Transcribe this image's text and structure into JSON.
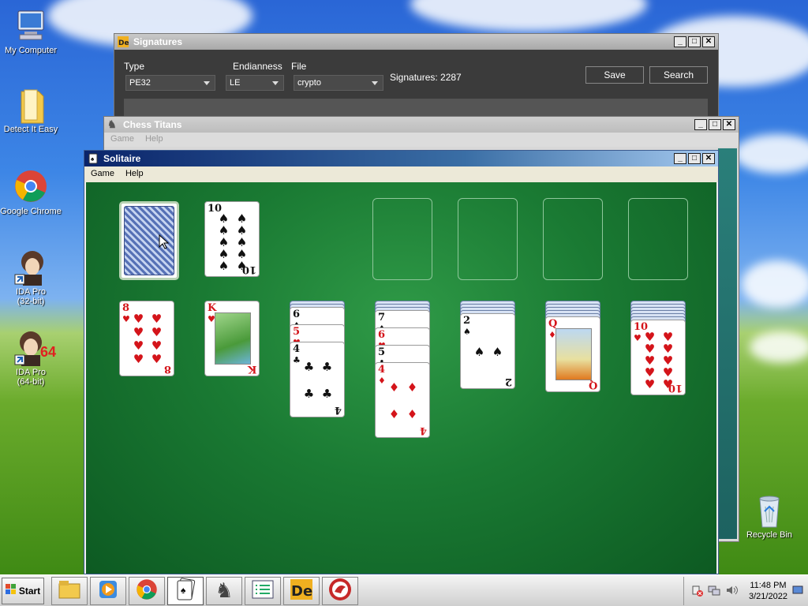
{
  "desktop": {
    "icons": [
      {
        "label": "My Computer",
        "icon": "my-computer-icon"
      },
      {
        "label": "Detect It Easy",
        "icon": "folder-icon"
      },
      {
        "label": "Google Chrome",
        "icon": "chrome-icon"
      },
      {
        "label": "IDA Pro",
        "sublabel": "(32-bit)",
        "icon": "ida-pro-icon"
      },
      {
        "label": "IDA Pro",
        "sublabel": "(64-bit)",
        "badge": "64",
        "icon": "ida-pro-64-icon"
      },
      {
        "label": "Recycle Bin",
        "icon": "recycle-bin-icon"
      }
    ]
  },
  "die_window": {
    "title": "Signatures",
    "type_label": "Type",
    "type_value": "PE32",
    "endianness_label": "Endianness",
    "endianness_value": "LE",
    "file_label": "File",
    "file_value": "crypto",
    "signatures_text": "Signatures: 2287",
    "save_label": "Save",
    "search_label": "Search"
  },
  "chess_window": {
    "title": "Chess Titans",
    "menu": [
      "Game",
      "Help"
    ]
  },
  "solitaire_window": {
    "title": "Solitaire",
    "menu": [
      "Game",
      "Help"
    ],
    "waste_card": {
      "rank": "10",
      "suit": "♠",
      "color": "black"
    },
    "tableau": [
      {
        "hidden": 0,
        "cards": [
          {
            "rank": "8",
            "suit": "♥",
            "color": "red"
          }
        ]
      },
      {
        "hidden": 0,
        "cards": [
          {
            "rank": "K",
            "suit": "♥",
            "color": "red",
            "face": true
          }
        ]
      },
      {
        "hidden": 2,
        "cards": [
          {
            "rank": "6",
            "suit": "♠",
            "color": "black"
          },
          {
            "rank": "5",
            "suit": "♥",
            "color": "red"
          },
          {
            "rank": "4",
            "suit": "♣",
            "color": "black"
          }
        ]
      },
      {
        "hidden": 3,
        "cards": [
          {
            "rank": "7",
            "suit": "♠",
            "color": "black"
          },
          {
            "rank": "6",
            "suit": "♥",
            "color": "red"
          },
          {
            "rank": "5",
            "suit": "♣",
            "color": "black"
          },
          {
            "rank": "4",
            "suit": "♦",
            "color": "red"
          }
        ]
      },
      {
        "hidden": 4,
        "cards": [
          {
            "rank": "2",
            "suit": "♠",
            "color": "black"
          }
        ]
      },
      {
        "hidden": 5,
        "cards": [
          {
            "rank": "Q",
            "suit": "♦",
            "color": "red",
            "face": true
          }
        ]
      },
      {
        "hidden": 6,
        "cards": [
          {
            "rank": "10",
            "suit": "♥",
            "color": "red"
          }
        ]
      }
    ]
  },
  "taskbar": {
    "start_label": "Start",
    "apps": [
      "file-explorer-icon",
      "media-player-icon",
      "chrome-icon",
      "solitaire-icon",
      "chess-icon",
      "task-list-icon",
      "detect-it-easy-icon",
      "ida-icon"
    ],
    "active_app": "solitaire-icon",
    "time": "11:48 PM",
    "date": "3/21/2022"
  },
  "colors": {
    "felt": "#1a7a33",
    "red_suit": "#d4141a",
    "title_active": "#0a246a"
  }
}
